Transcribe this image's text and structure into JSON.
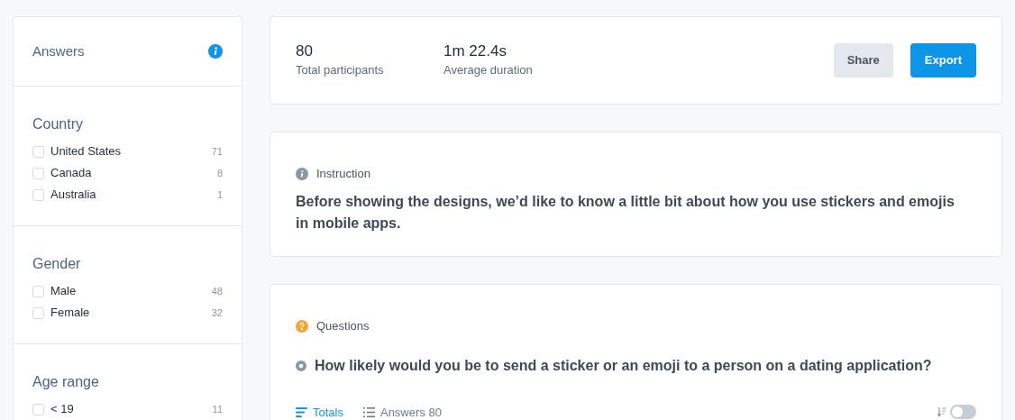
{
  "sidebar": {
    "title": "Answers",
    "filters": [
      {
        "title": "Country",
        "options": [
          {
            "label": "United States",
            "count": "71",
            "checked": false
          },
          {
            "label": "Canada",
            "count": "8",
            "checked": false
          },
          {
            "label": "Australia",
            "count": "1",
            "checked": false
          }
        ]
      },
      {
        "title": "Gender",
        "options": [
          {
            "label": "Male",
            "count": "48",
            "checked": false
          },
          {
            "label": "Female",
            "count": "32",
            "checked": false
          }
        ]
      },
      {
        "title": "Age range",
        "options": [
          {
            "label": "< 19",
            "count": "11",
            "checked": false
          }
        ]
      }
    ]
  },
  "summary": {
    "stats": [
      {
        "value": "80",
        "label": "Total participants"
      },
      {
        "value": "1m 22.4s",
        "label": "Average duration"
      }
    ],
    "buttons": [
      {
        "label": "Share",
        "kind": "secondary"
      },
      {
        "label": "Export",
        "kind": "primary"
      }
    ]
  },
  "instruction": {
    "heading": "Instruction",
    "text": "Before showing the designs, we’d like to know a little bit about how you use stickers and emojis in mobile apps."
  },
  "questions": {
    "heading": "Questions",
    "question": "How likely would you be to send a sticker or an emoji to a person on a dating application?",
    "tabs": [
      {
        "label": "Totals",
        "selected": true
      },
      {
        "label": "Answers 80",
        "selected": false
      }
    ],
    "sort_toggle": {
      "on": false
    }
  }
}
